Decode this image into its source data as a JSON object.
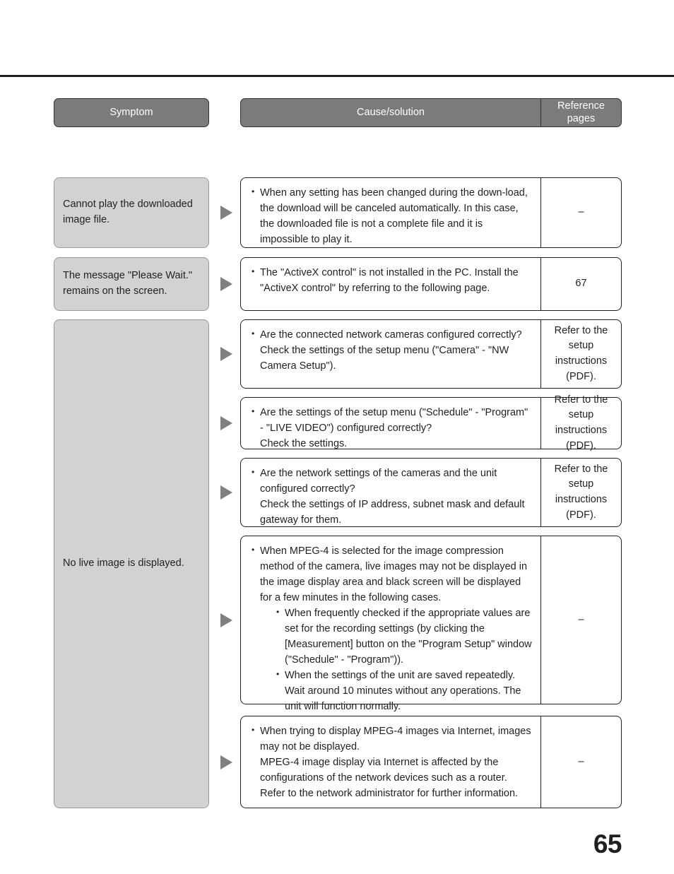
{
  "page": {
    "number": "65",
    "accent_header_bg": "#7b7b7b",
    "symptom_bg": "#d2d2d2",
    "arrow_color": "#808080",
    "text_color": "#231f20"
  },
  "header": {
    "symptom_label": "Symptom",
    "cause_label": "Cause/solution",
    "reference_label_line1": "Reference",
    "reference_label_line2": "pages"
  },
  "symptoms": [
    {
      "id": "cannot-play-downloaded-image-file",
      "text": "Cannot play the downloaded image file."
    },
    {
      "id": "please-wait-remains-on-screen",
      "text": "The message \"Please Wait.\" remains on the screen."
    },
    {
      "id": "no-live-image-is-displayed",
      "text": "No live image is displayed."
    }
  ],
  "rows": [
    {
      "id": "row-download-canceled",
      "bullets": [
        {
          "lines": [
            "When any setting has been changed during the down-load, the download will be canceled automatically. In this case, the downloaded file is not a complete file and it is impossible to play it."
          ]
        }
      ],
      "reference": "–"
    },
    {
      "id": "row-activex-not-installed",
      "bullets": [
        {
          "lines": [
            "The \"ActiveX control\" is not installed in the PC. Install the \"ActiveX control\" by referring to the following page."
          ]
        }
      ],
      "reference": "67"
    },
    {
      "id": "row-network-cameras-configured",
      "bullets": [
        {
          "lines": [
            "Are the connected network cameras configured correctly?",
            "Check the settings of the setup menu (\"Camera\" - \"NW Camera Setup\")."
          ]
        }
      ],
      "reference": "Refer to the setup instructions (PDF)."
    },
    {
      "id": "row-schedule-program-live-video",
      "bullets": [
        {
          "lines": [
            "Are the settings of the setup menu (\"Schedule\" - \"Program\" - \"LIVE VIDEO\") configured correctly?",
            "Check the settings."
          ]
        }
      ],
      "reference": "Refer to the setup instructions (PDF)."
    },
    {
      "id": "row-network-settings-cameras-unit",
      "bullets": [
        {
          "lines": [
            "Are the network settings of the cameras and the unit configured correctly?",
            "Check the settings of IP address, subnet mask and default gateway for them."
          ]
        }
      ],
      "reference": "Refer to the setup instructions (PDF)."
    },
    {
      "id": "row-mpeg4-black-screen",
      "bullets": [
        {
          "lines": [
            "When MPEG-4 is selected for the image compression method of the camera, live images may not be displayed in the image display area and black screen will be displayed for a few minutes in the following cases."
          ],
          "sub": [
            "When frequently checked if the appropriate values are set for the recording settings (by clicking the [Measurement] button on the \"Program Setup\" window (\"Schedule\" - \"Program\")).",
            "When the settings of the unit are saved repeatedly. Wait around 10 minutes without any operations. The unit will function normally."
          ]
        }
      ],
      "reference": "–"
    },
    {
      "id": "row-mpeg4-via-internet",
      "bullets": [
        {
          "lines": [
            "When trying to display MPEG-4 images via Internet, images may not be displayed.",
            "MPEG-4 image display via Internet is affected by the configurations of the network devices such as a router. Refer to the network administrator for further information."
          ]
        }
      ],
      "reference": "–"
    }
  ]
}
